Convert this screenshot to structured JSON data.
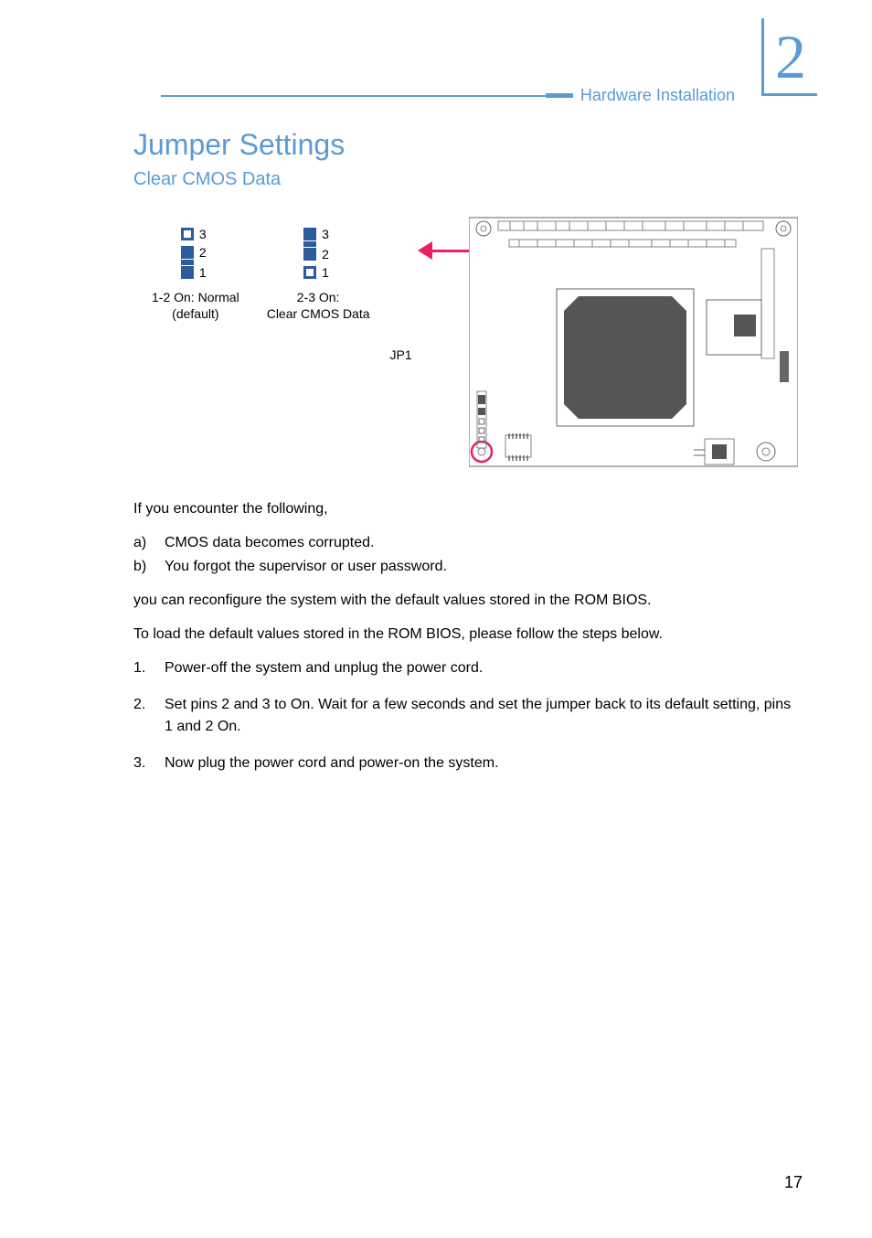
{
  "header": {
    "section_name": "Hardware Installation",
    "chapter_number": "2"
  },
  "title": "Jumper Settings",
  "subtitle": "Clear CMOS Data",
  "jumper1": {
    "pin3": "3",
    "pin2": "2",
    "pin1": "1",
    "caption_line1": "1-2 On: Normal",
    "caption_line2": "(default)"
  },
  "jumper2": {
    "pin3": "3",
    "pin2": "2",
    "pin1": "1",
    "caption_line1": "2-3 On:",
    "caption_line2": "Clear CMOS Data"
  },
  "jp1_label": "JP1",
  "intro": "If you encounter the following,",
  "conditions": {
    "a_marker": "a)",
    "a_text": "CMOS data becomes corrupted.",
    "b_marker": "b)",
    "b_text": "You forgot the supervisor or user password."
  },
  "reconfigure": "you can reconfigure the system with the default values stored in the ROM BIOS.",
  "steps_intro": "To load the default values stored in the ROM BIOS, please follow the steps below.",
  "steps": {
    "s1_marker": "1.",
    "s1_text": "Power-off the system and unplug the power cord.",
    "s2_marker": "2.",
    "s2_text": "Set pins 2 and 3 to On. Wait for a few seconds and set the jumper back to its default setting, pins 1 and 2 On.",
    "s3_marker": "3.",
    "s3_text": "Now plug the power cord and power-on the system."
  },
  "page_number": "17"
}
